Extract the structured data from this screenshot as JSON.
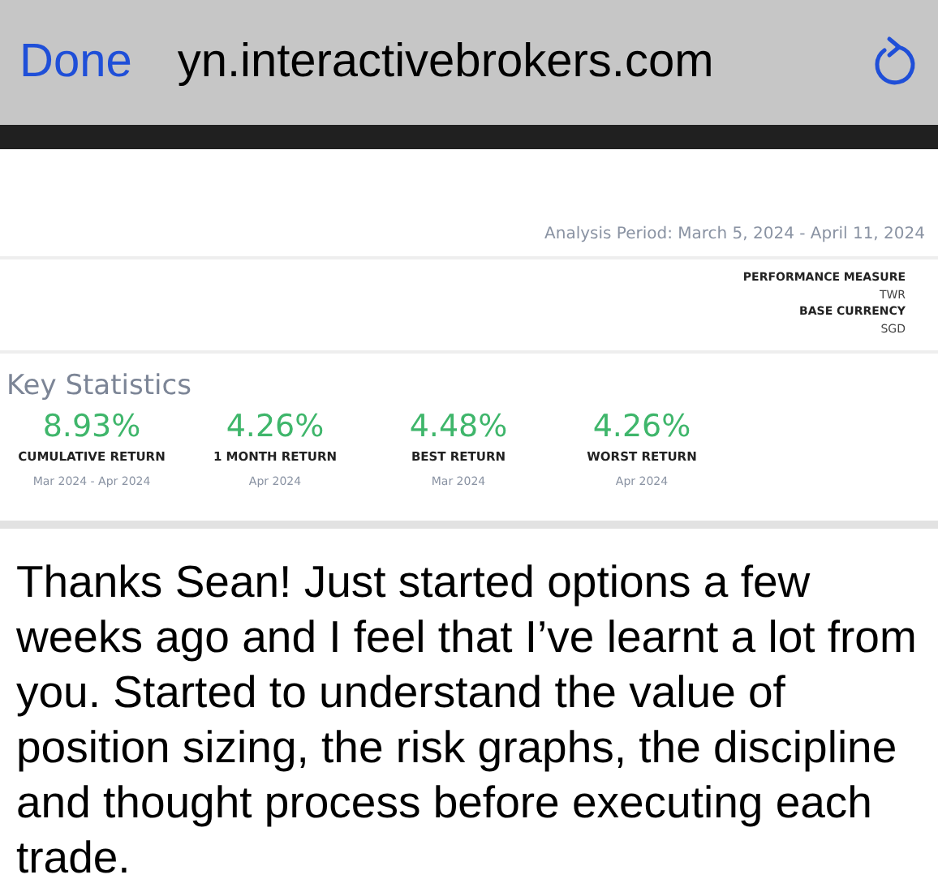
{
  "browser_bar": {
    "done": "Done",
    "url": "yn.interactivebrokers.com"
  },
  "report": {
    "analysis_period": "Analysis Period: March 5, 2024 - April 11, 2024",
    "settings": [
      {
        "label": "PERFORMANCE MEASURE",
        "value": "TWR"
      },
      {
        "label": "BASE CURRENCY",
        "value": "SGD"
      }
    ],
    "section_title": "Key Statistics",
    "stats": [
      {
        "value": "8.93%",
        "label": "CUMULATIVE RETURN",
        "period": "Mar 2024 - Apr 2024"
      },
      {
        "value": "4.26%",
        "label": "1 MONTH RETURN",
        "period": "Apr 2024"
      },
      {
        "value": "4.48%",
        "label": "BEST RETURN",
        "period": "Mar 2024"
      },
      {
        "value": "4.26%",
        "label": "WORST RETURN",
        "period": "Apr 2024"
      }
    ]
  },
  "message": "Thanks Sean! Just started options a few weeks ago and I feel that I’ve learnt a lot from you. Started to understand the value of position sizing, the risk graphs, the discipline and thought process before executing each trade."
}
